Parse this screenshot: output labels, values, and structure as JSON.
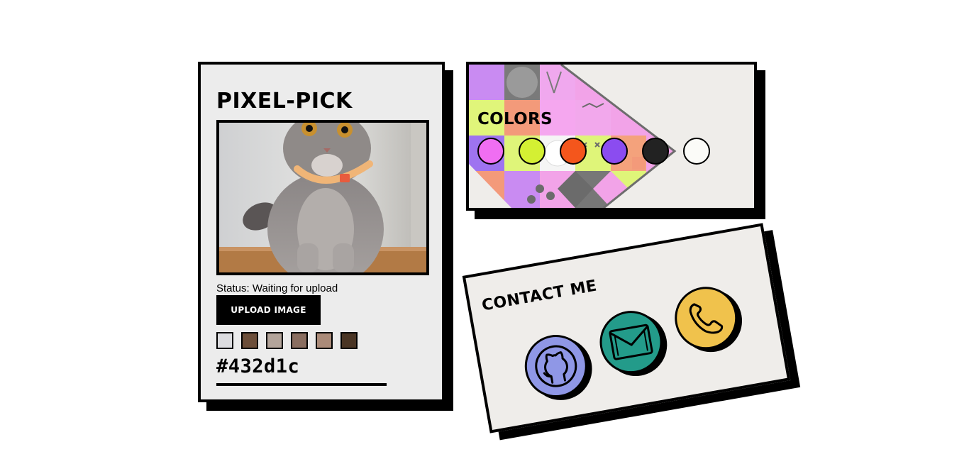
{
  "pick": {
    "title": "PIXEL-PICK",
    "status": "Status: Waiting for upload",
    "upload_label": "UPLOAD IMAGE",
    "hex": "#432d1c",
    "swatches": [
      "#dcdcdf",
      "#6d4f3a",
      "#b3a49a",
      "#8a6e60",
      "#ab8b79",
      "#4a3524"
    ]
  },
  "colors": {
    "title": "COLORS",
    "dots": [
      "#f06ef2",
      "#d4f033",
      "#f4561c",
      "#8b4cf0",
      "#222222",
      "#fbfbf8"
    ]
  },
  "contact": {
    "title": "CONTACT ME",
    "buttons": [
      {
        "icon": "github-icon",
        "color": "#8f97e6"
      },
      {
        "icon": "mail-icon",
        "color": "#239b8a"
      },
      {
        "icon": "phone-icon",
        "color": "#f0c24c"
      }
    ]
  }
}
